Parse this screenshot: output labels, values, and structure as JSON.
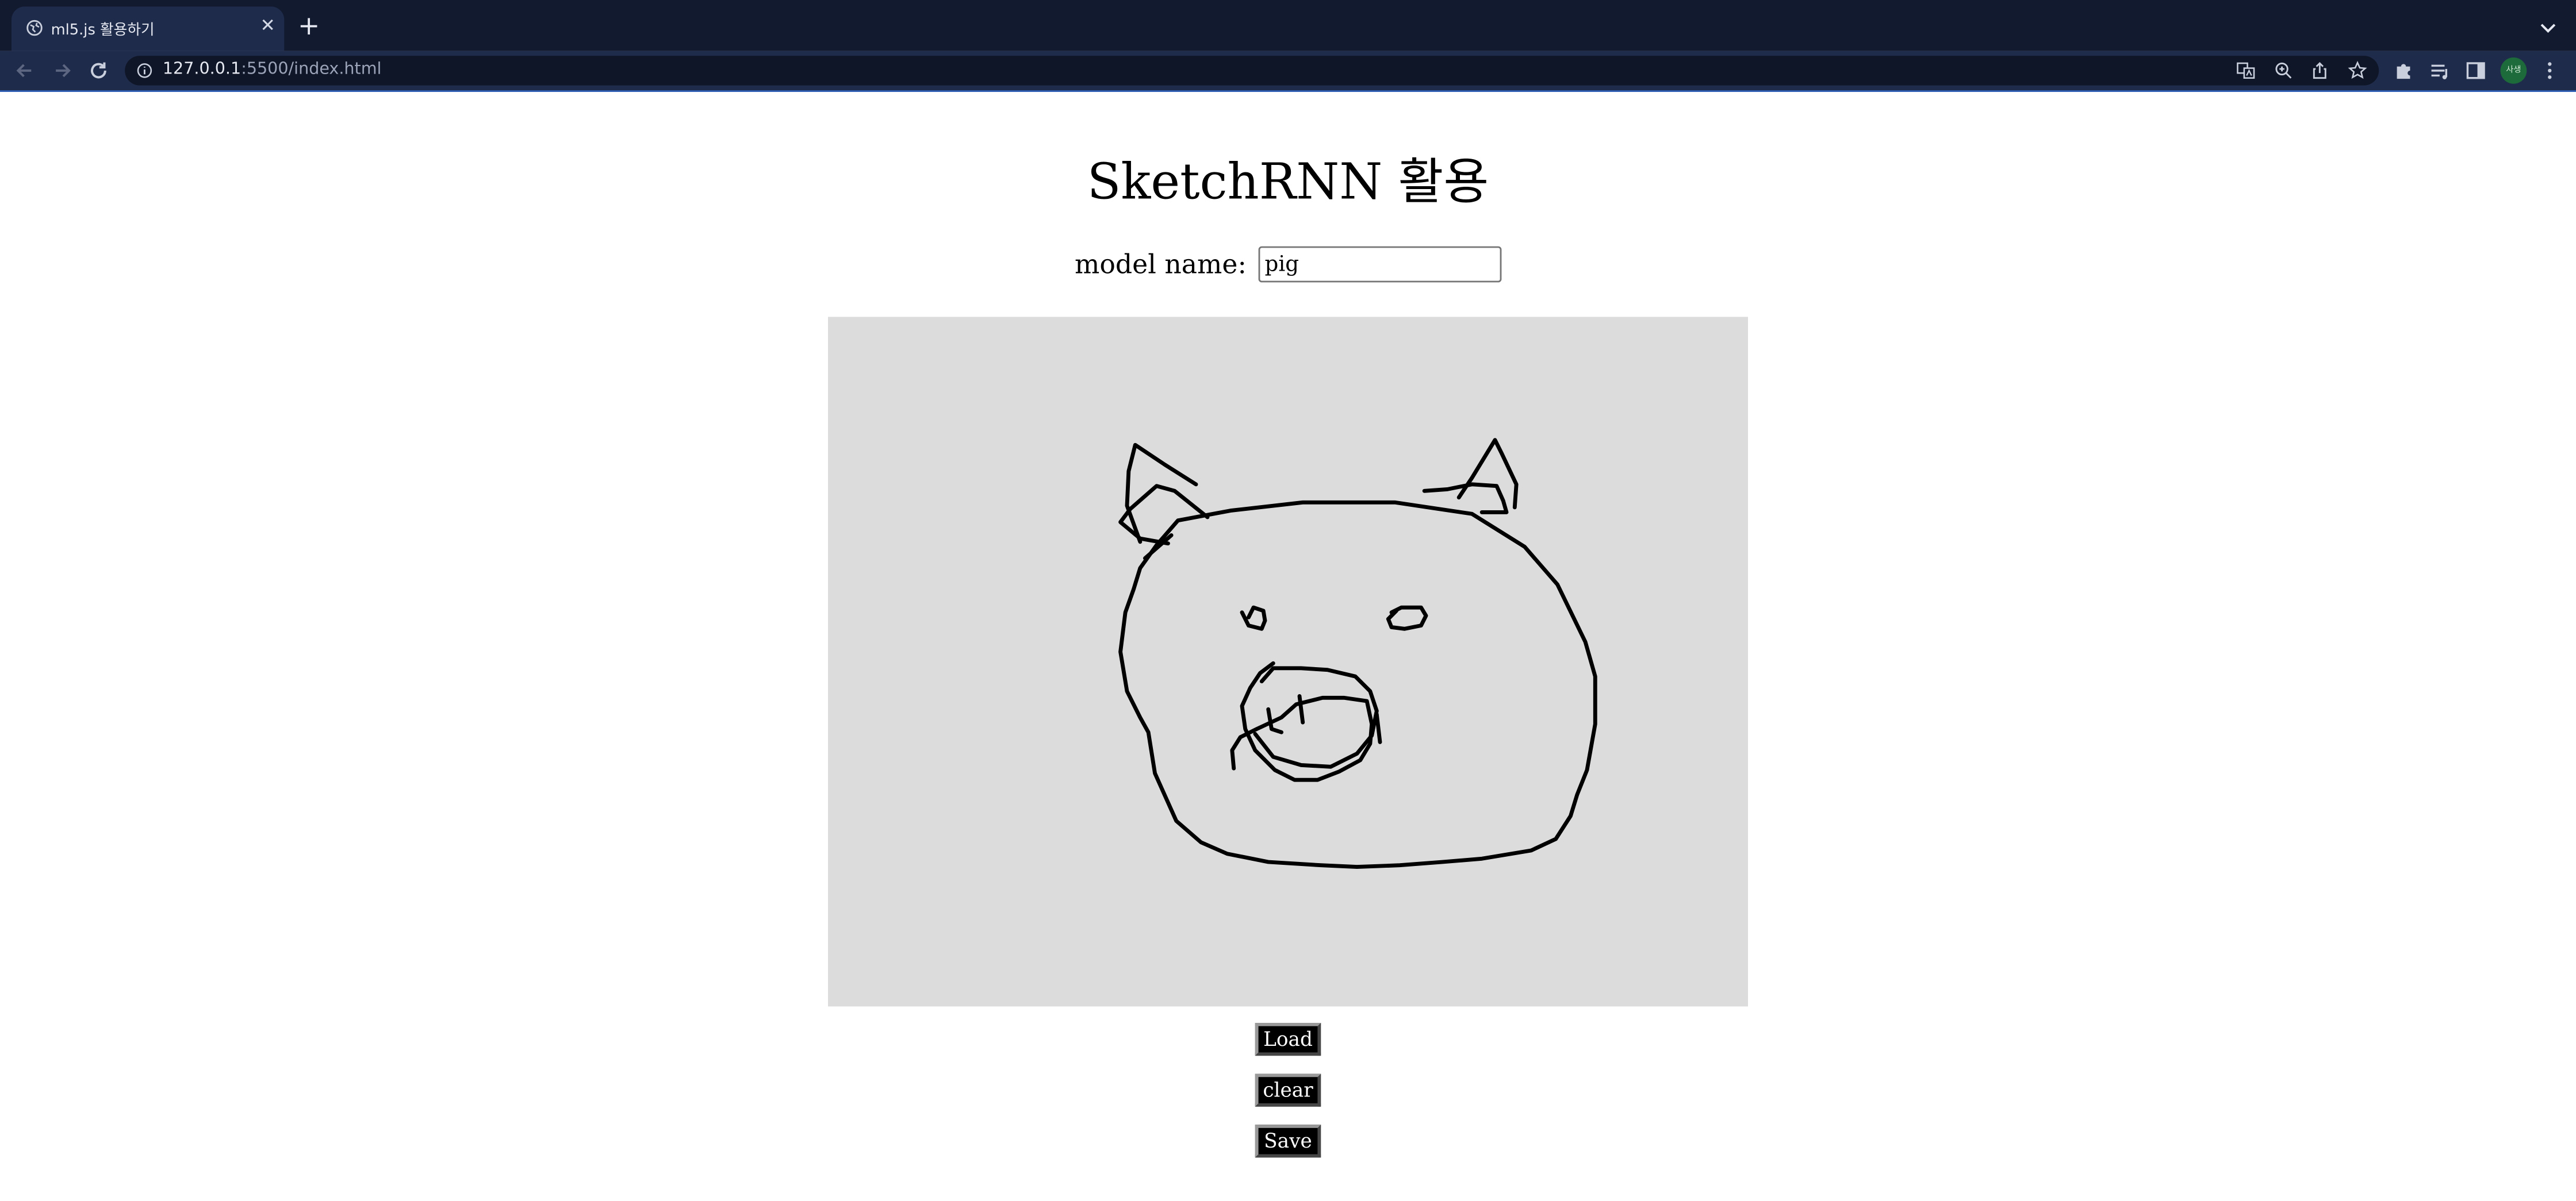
{
  "browser": {
    "tab_title": "ml5.js 활용하기",
    "url_host": "127.0.0.1",
    "url_rest": ":5500/index.html",
    "profile_label": "사생"
  },
  "page": {
    "title": "SketchRNN 활용",
    "model_label": "model name:",
    "model_value": "pig"
  },
  "buttons": {
    "load": "Load",
    "clear": "clear",
    "save": "Save"
  },
  "colors": {
    "tabstrip": "#121a30",
    "toolbar": "#1f2b4b",
    "canvas_bg": "#dcdcdc",
    "button_bg": "#000000"
  }
}
